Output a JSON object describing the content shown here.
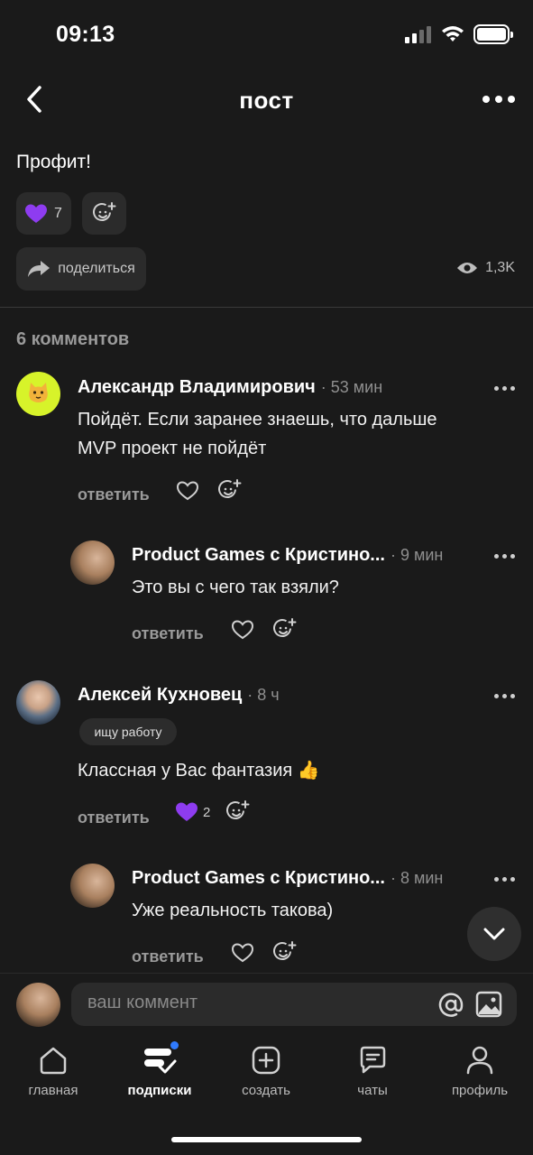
{
  "status": {
    "time": "09:13"
  },
  "header": {
    "title": "пост"
  },
  "post": {
    "text": "Профит!",
    "reaction_count": "7",
    "share_label": "поделиться",
    "views": "1,3K"
  },
  "comments_count_label": "6 комментов",
  "comments": [
    {
      "author": "Александр Владимирович",
      "time": "· 53 мин",
      "text_line1": "Пойдёт. Если заранее знаешь, что дальше",
      "text_line2": "MVP проект не пойдёт",
      "reply": "ответить"
    },
    {
      "author": "Product Games с Кристино...",
      "time": "· 9 мин",
      "text": "Это вы с чего так взяли?",
      "reply": "ответить"
    },
    {
      "author": "Алексей Кухновец",
      "time": "· 8 ч",
      "badge": "ищу работу",
      "text": "Классная у Вас фантазия 👍",
      "reaction_count": "2",
      "reply": "ответить"
    },
    {
      "author": "Product Games с Кристино...",
      "time": "· 8 мин",
      "text": "Уже реальность такова)",
      "reply": "ответить"
    }
  ],
  "composer": {
    "placeholder": "ваш коммент"
  },
  "tabs": [
    {
      "label": "главная",
      "icon": "home-icon"
    },
    {
      "label": "подписки",
      "icon": "subscriptions-icon",
      "active": true
    },
    {
      "label": "создать",
      "icon": "plus-icon"
    },
    {
      "label": "чаты",
      "icon": "chat-icon"
    },
    {
      "label": "профиль",
      "icon": "profile-icon"
    }
  ],
  "colors": {
    "background": "#1a1a1a",
    "chip": "#2b2b2b",
    "muted": "#9a9a9a",
    "notification_dot": "#2f7bff",
    "reaction": "#8e3cf0"
  }
}
